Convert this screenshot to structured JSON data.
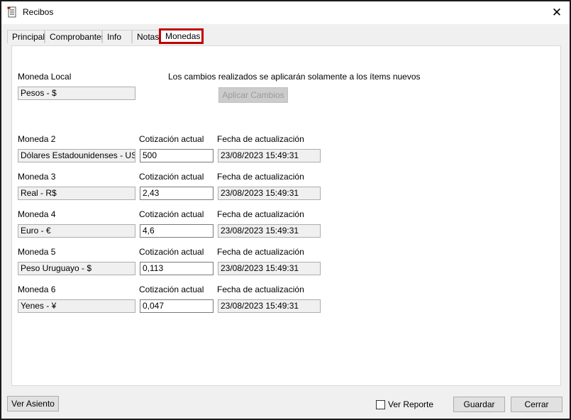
{
  "window": {
    "title": "Recibos",
    "close_glyph": "✕"
  },
  "tabs": [
    {
      "label": "Principal"
    },
    {
      "label": "Comprobantes"
    },
    {
      "label": "Info"
    },
    {
      "label": "Notas"
    },
    {
      "label": "Monedas",
      "active": true
    }
  ],
  "local": {
    "label": "Moneda Local",
    "value": "Pesos - $",
    "notice": "Los cambios realizados se aplicarán solamente a los ítems nuevos",
    "apply_label": "Aplicar Cambios"
  },
  "headers": {
    "rate": "Cotización actual",
    "date": "Fecha de actualización"
  },
  "currencies": [
    {
      "label": "Moneda 2",
      "name": "Dólares Estadounidenses - USD",
      "rate": "500",
      "date": "23/08/2023 15:49:31"
    },
    {
      "label": "Moneda 3",
      "name": "Real - R$",
      "rate": "2,43",
      "date": "23/08/2023 15:49:31"
    },
    {
      "label": "Moneda 4",
      "name": "Euro - €",
      "rate": "4,6",
      "date": "23/08/2023 15:49:31"
    },
    {
      "label": "Moneda 5",
      "name": "Peso Uruguayo - $",
      "rate": "0,113",
      "date": "23/08/2023 15:49:31"
    },
    {
      "label": "Moneda 6",
      "name": "Yenes - ¥",
      "rate": "0,047",
      "date": "23/08/2023 15:49:31"
    }
  ],
  "footer": {
    "ver_asiento": "Ver Asiento",
    "ver_reporte": "Ver Reporte",
    "guardar": "Guardar",
    "cerrar": "Cerrar"
  },
  "colors": {
    "active_tab_border": "#c00000",
    "window_bg": "#f0f0f0",
    "panel_bg": "#ffffff"
  }
}
